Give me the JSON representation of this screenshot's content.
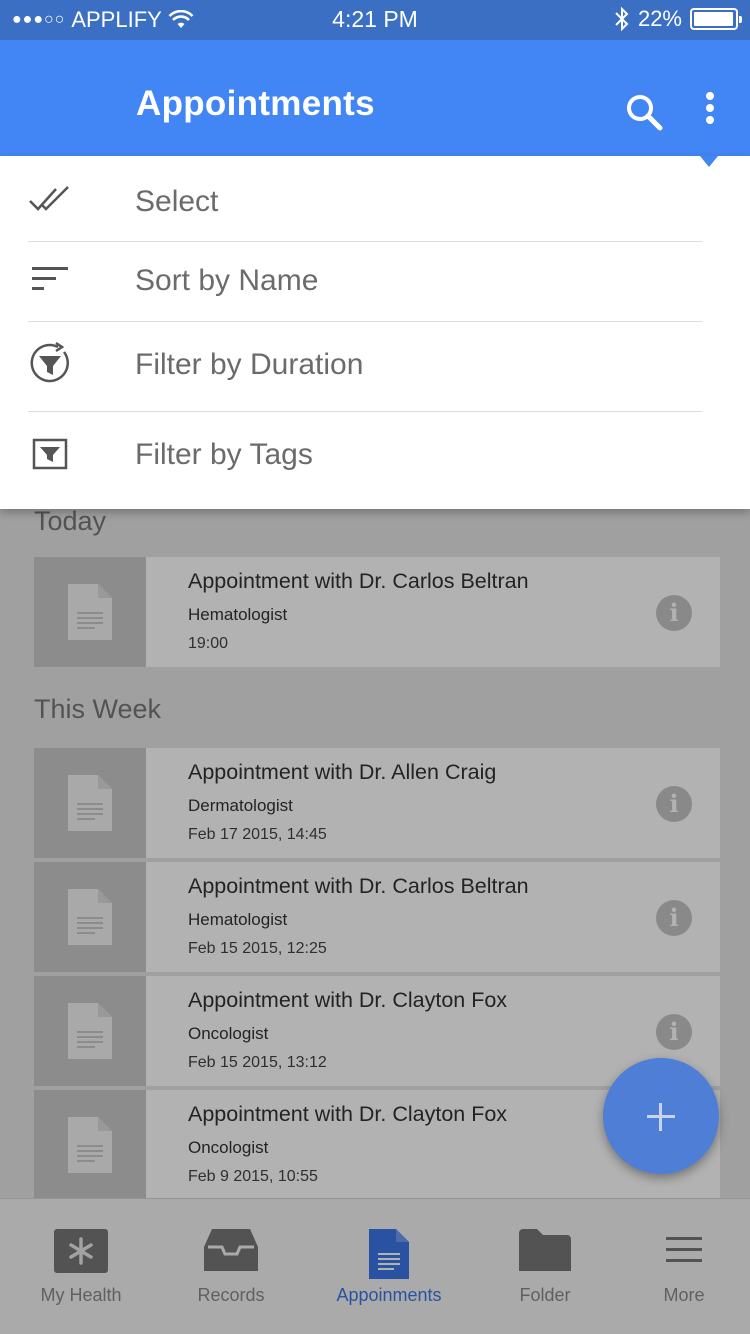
{
  "status_bar": {
    "carrier": "APPLIFY",
    "signal_dots": "●●●○○",
    "time": "4:21 PM",
    "battery": "22%"
  },
  "app_bar": {
    "title": "Appointments"
  },
  "menu": {
    "items": [
      {
        "label": "Select",
        "icon": "double-check-icon"
      },
      {
        "label": "Sort by Name",
        "icon": "sort-icon"
      },
      {
        "label": "Filter by Duration",
        "icon": "timer-filter-icon"
      },
      {
        "label": "Filter by Tags",
        "icon": "tag-filter-icon"
      }
    ]
  },
  "sections": [
    {
      "title": "Today",
      "appointments": [
        {
          "title": "Appointment with Dr. Carlos Beltran",
          "specialty": "Hematologist",
          "time": "19:00"
        }
      ]
    },
    {
      "title": "This Week",
      "appointments": [
        {
          "title": "Appointment with Dr. Allen Craig",
          "specialty": "Dermatologist",
          "time": "Feb 17 2015, 14:45"
        },
        {
          "title": "Appointment with Dr. Carlos Beltran",
          "specialty": "Hematologist",
          "time": "Feb 15 2015, 12:25"
        },
        {
          "title": "Appointment with Dr. Clayton Fox",
          "specialty": "Oncologist",
          "time": "Feb 15 2015, 13:12"
        },
        {
          "title": "Appointment with Dr. Clayton Fox",
          "specialty": "Oncologist",
          "time": "Feb 9 2015, 10:55"
        }
      ]
    }
  ],
  "info_glyph": "i",
  "tabs": [
    {
      "label": "My Health",
      "icon": "asterisk-icon"
    },
    {
      "label": "Records",
      "icon": "inbox-icon"
    },
    {
      "label": "Appoinments",
      "icon": "document-icon",
      "active": true
    },
    {
      "label": "Folder",
      "icon": "folder-icon"
    },
    {
      "label": "More",
      "icon": "menu-lines-icon"
    }
  ],
  "colors": {
    "accent": "#4285f4",
    "status_bar": "#3a6fc4",
    "active_tab": "#3c78e8",
    "fab": "#4f7ed6"
  }
}
